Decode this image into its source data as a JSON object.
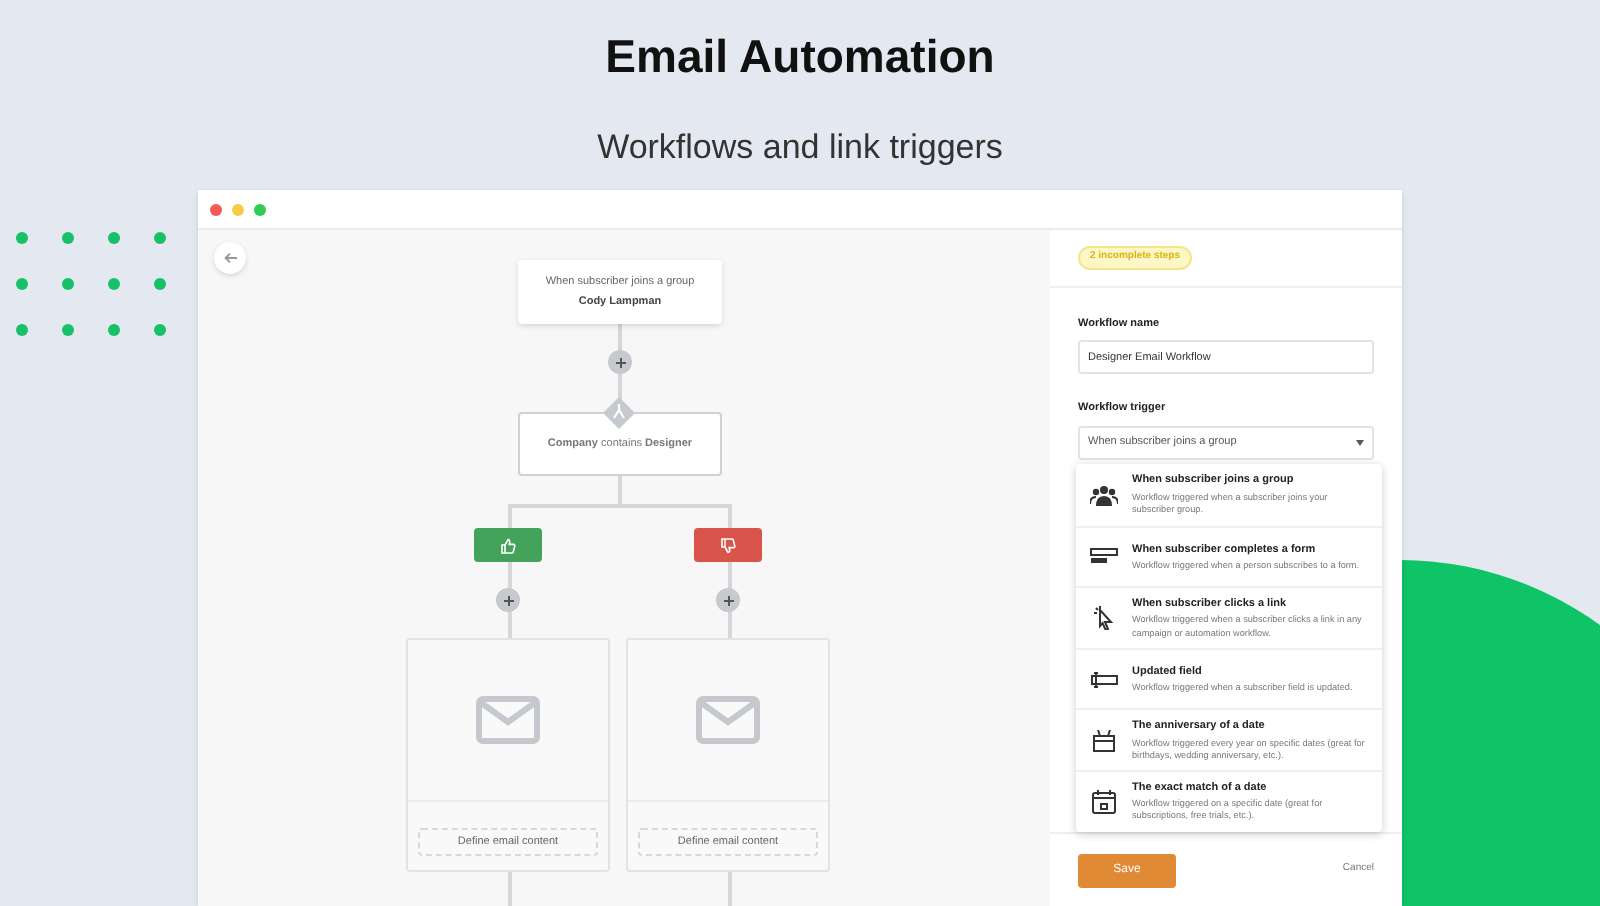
{
  "header": {
    "title": "Email Automation",
    "subtitle": "Workflows and link triggers"
  },
  "canvas": {
    "trigger_node": {
      "label": "When subscriber joins a group",
      "value": "Cody Lampman"
    },
    "condition_node": {
      "text": "**Company** contains **Designer**"
    },
    "branches": [
      {
        "kind": "yes",
        "action": "Define email content"
      },
      {
        "kind": "no",
        "action": "Define email content"
      }
    ]
  },
  "panel": {
    "badge": "2 incomplete steps",
    "name_field": {
      "label": "Workflow name",
      "value": "Designer Email Workflow"
    },
    "trigger_field": {
      "label": "Workflow trigger",
      "value": "When subscriber joins a group"
    },
    "trigger_options": [
      {
        "kind": "group",
        "title": "When subscriber joins a group",
        "description": "Workflow triggered when a subscriber joins your subscriber group."
      },
      {
        "kind": "form",
        "title": "When subscriber completes a form",
        "description": "Workflow triggered when a person subscribes to a form."
      },
      {
        "kind": "click",
        "title": "When subscriber clicks a link",
        "description": "Workflow triggered when a subscriber clicks a link in any campaign or automation workflow."
      },
      {
        "kind": "field",
        "title": "Updated field",
        "description": "Workflow triggered when a subscriber field is updated."
      },
      {
        "kind": "anniversary",
        "title": "The anniversary of a date",
        "description": "Workflow triggered every year on specific dates (great for birthdays, wedding anniversary, etc.)."
      },
      {
        "kind": "date",
        "title": "The exact match of a date",
        "description": "Workflow triggered on a specific date (great for subscriptions, free trials, etc.)."
      }
    ],
    "buttons": {
      "save": "Save",
      "cancel": "Cancel"
    }
  }
}
